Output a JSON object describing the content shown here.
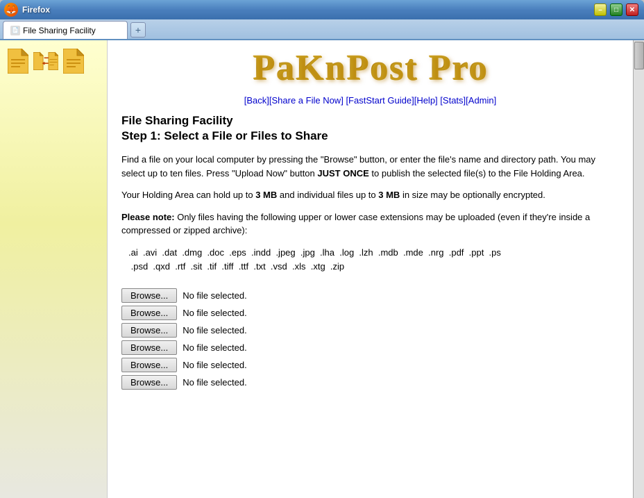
{
  "window": {
    "title": "Firefox",
    "tab_title": "File Sharing Facility",
    "controls": {
      "minimize": "–",
      "maximize": "□",
      "close": "✕"
    }
  },
  "app": {
    "logo": "PaKnPost Pro",
    "nav_links": [
      {
        "label": "Back",
        "href": "#"
      },
      {
        "label": "Share a File Now",
        "href": "#"
      },
      {
        "label": "FastStart Guide",
        "href": "#"
      },
      {
        "label": "Help",
        "href": "#"
      },
      {
        "label": "Stats",
        "href": "#"
      },
      {
        "label": "Admin",
        "href": "#"
      }
    ],
    "page_title": "File Sharing Facility",
    "step_title": "Step 1: Select a File or Files to Share",
    "description": "Find a file on your local computer by pressing the \"Browse\" button, or enter the file's name and directory path. You may select up to ten files. Press \"Upload Now\" button JUST ONCE to publish the selected file(s) to the File Holding Area.",
    "holding_area": "Your Holding Area can hold up to 3 MB  and individual files up to 3 MB in size may be optionally encrypted.",
    "holding_area_bold": "3 MB",
    "holding_area_bold2": "3 MB",
    "note_label": "Please note:",
    "note_text": " Only files having the following upper or lower case extensions may be uploaded (even if they're inside a compressed or zipped archive):",
    "extensions": ".ai  .avi  .dat  .dmg  .doc  .eps  .indd  .jpeg  .jpg  .lha  .log  .lzh  .mdb  .mde  .nrg  .pdf  .ppt  .ps  .psd  .qxd  .rtf  .sit  .tif  .tiff  .ttf  .txt  .vsd  .xls  .xtg  .zip",
    "file_inputs": [
      {
        "label": "Browse...",
        "placeholder": "No file selected."
      },
      {
        "label": "Browse...",
        "placeholder": "No file selected."
      },
      {
        "label": "Browse...",
        "placeholder": "No file selected."
      },
      {
        "label": "Browse...",
        "placeholder": "No file selected."
      },
      {
        "label": "Browse...",
        "placeholder": "No file selected."
      },
      {
        "label": "Browse...",
        "placeholder": "No file selected."
      }
    ]
  }
}
